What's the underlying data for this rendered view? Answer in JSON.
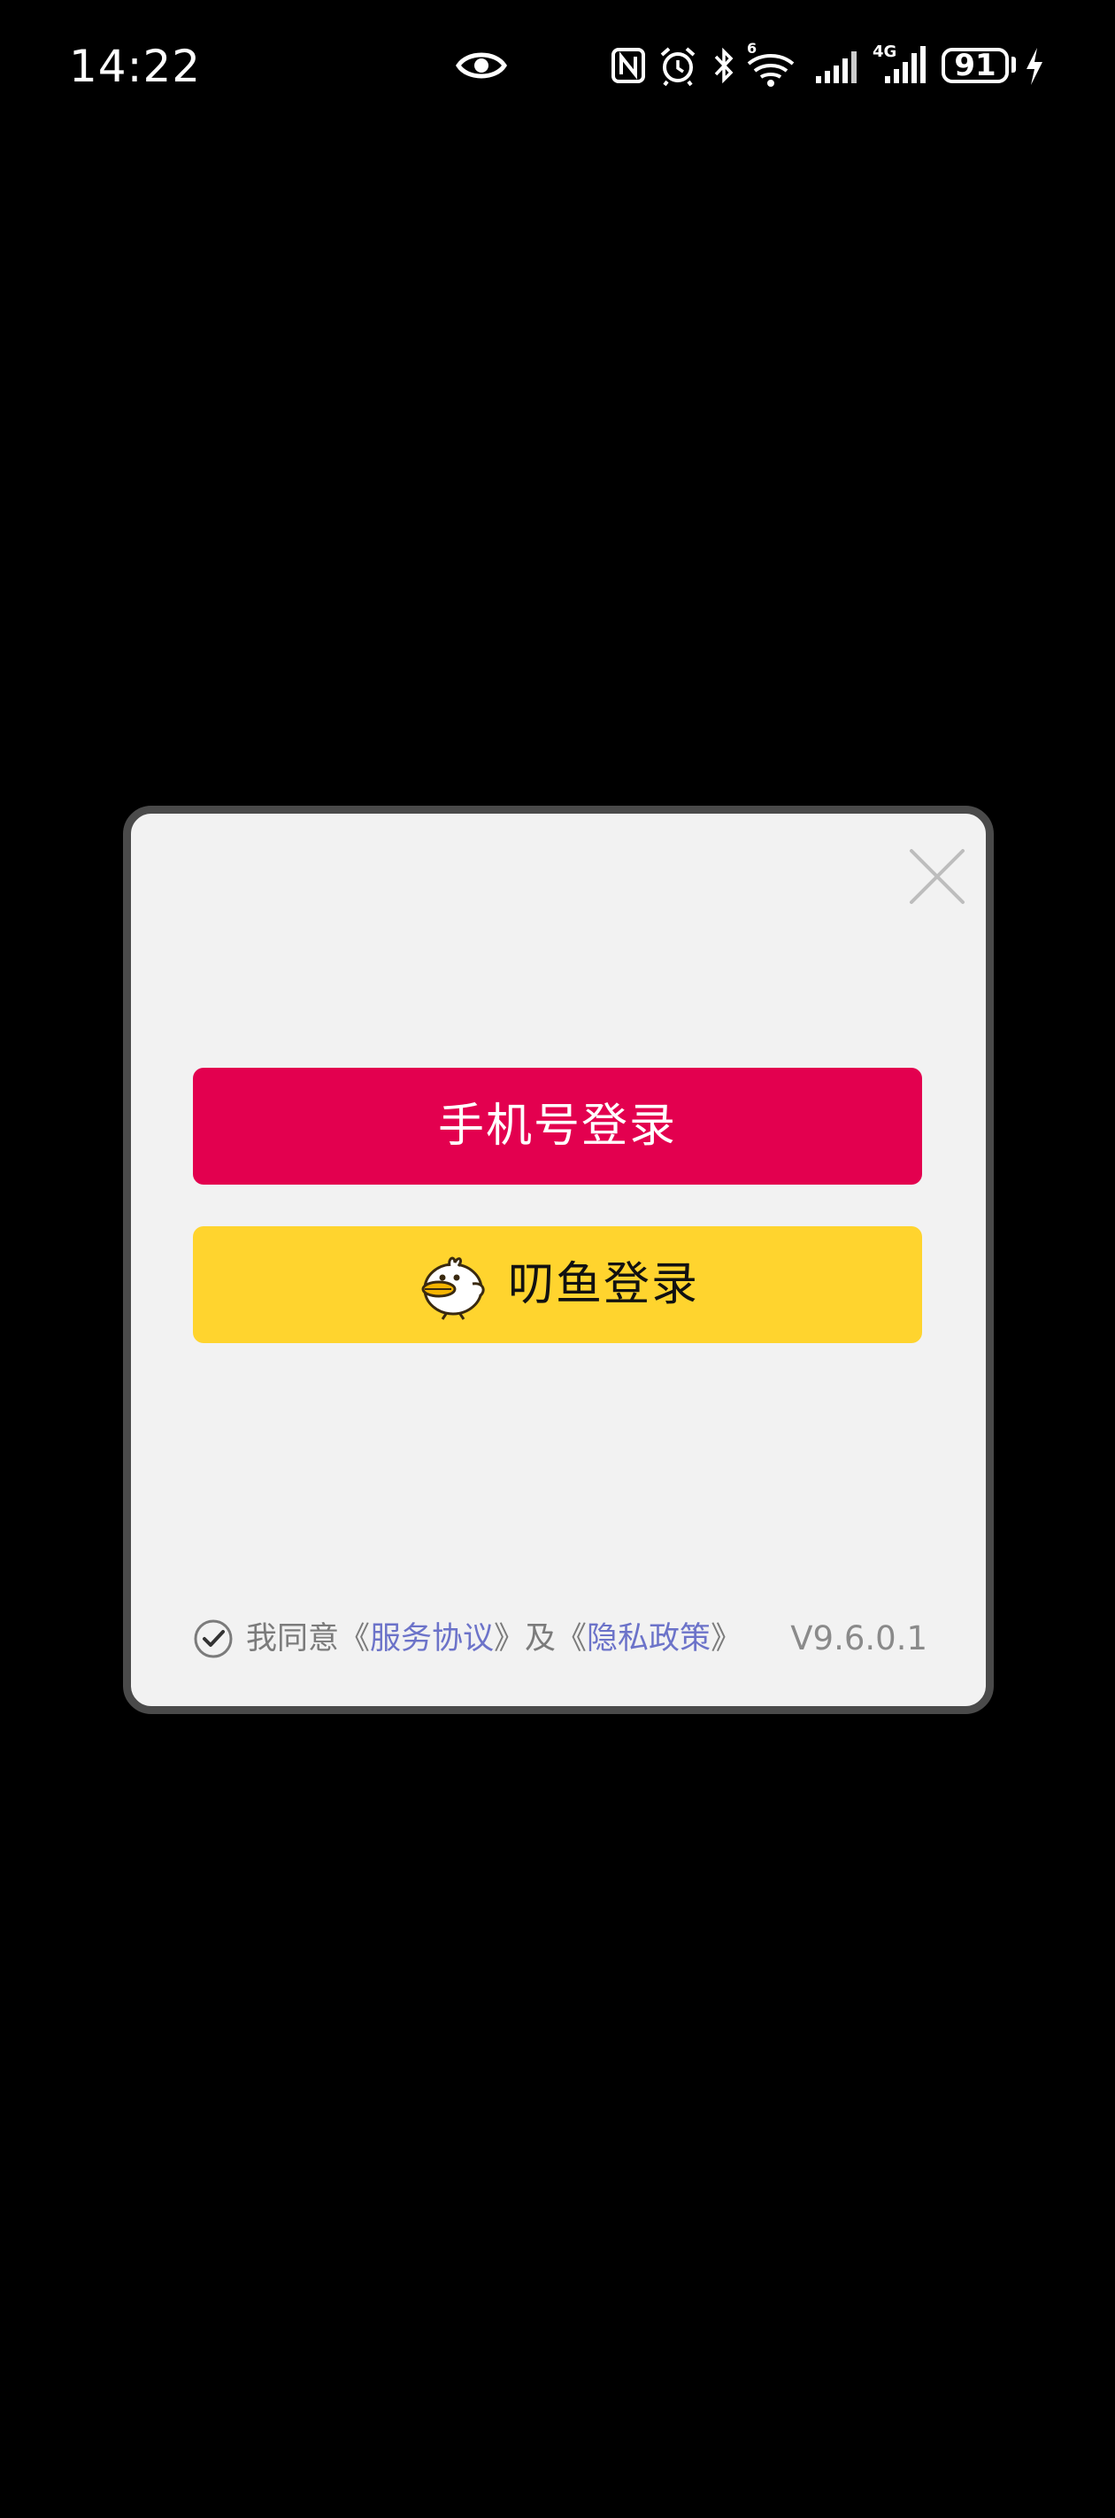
{
  "status_bar": {
    "time": "14:22",
    "battery": "91",
    "icons": [
      "eye-icon",
      "nfc-icon",
      "alarm-icon",
      "bluetooth-icon",
      "wifi-icon",
      "signal-icon",
      "4g-signal-icon",
      "battery-icon",
      "charging-icon"
    ],
    "wifi_badge": "6",
    "network_label": "4G"
  },
  "dialog": {
    "close_icon": "close-icon",
    "phone_login_label": "手机号登录",
    "diaoyu_login_label": "叨鱼登录",
    "diaoyu_icon": "duck-icon",
    "agreement": {
      "checked": true,
      "prefix": "我同意《",
      "service_link": "服务协议",
      "middle": "》及《",
      "privacy_link": "隐私政策",
      "suffix": "》"
    },
    "version": "V9.6.0.1"
  },
  "colors": {
    "background": "#000000",
    "dialog_bg": "#f2f2f2",
    "dialog_border": "#4a4a4a",
    "phone_button": "#e3004f",
    "diaoyu_button": "#ffd42e",
    "link": "#6c73c9"
  }
}
